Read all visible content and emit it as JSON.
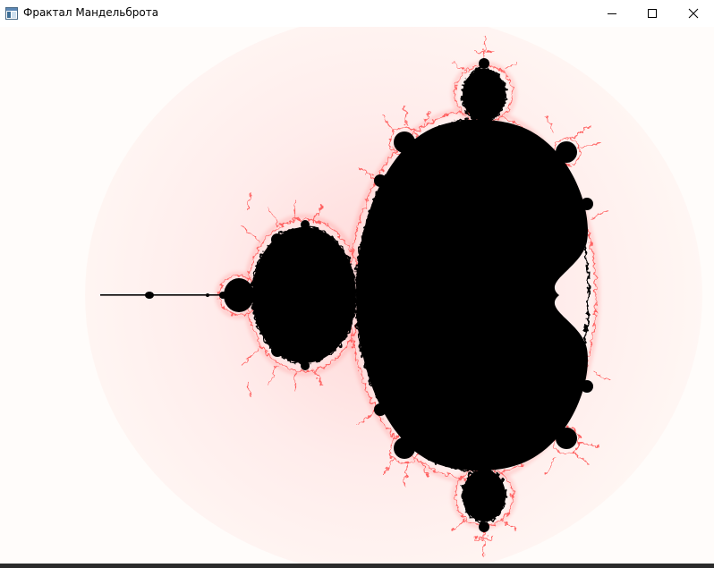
{
  "window": {
    "title": "Фрактал Мандельброта",
    "icon": "app-window-icon"
  },
  "controls": {
    "minimize_icon": "minimize-icon",
    "maximize_icon": "maximize-icon",
    "close_icon": "close-icon"
  },
  "canvas": {
    "content": "Mandelbrot set",
    "set_color": "#000000",
    "glow_color": "#ff3b3b",
    "background_color": "#fff6f3"
  }
}
